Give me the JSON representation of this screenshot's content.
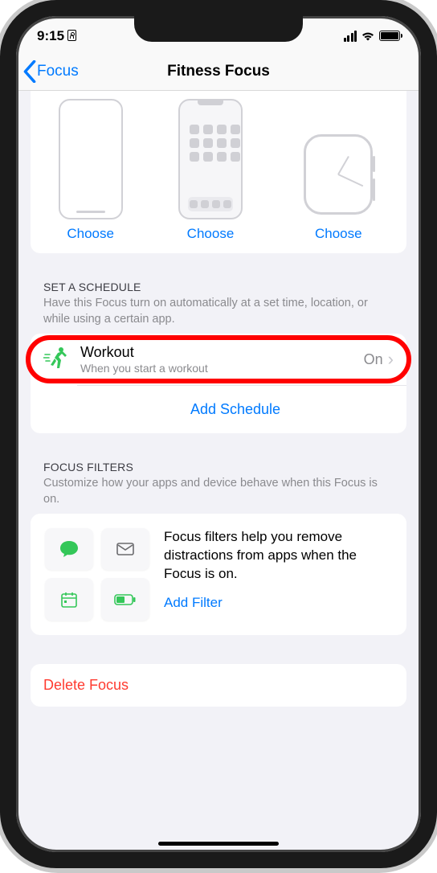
{
  "status": {
    "time": "9:15"
  },
  "nav": {
    "back_label": "Focus",
    "title": "Fitness Focus"
  },
  "choosers": {
    "lock": "Choose",
    "home": "Choose",
    "watch": "Choose"
  },
  "schedule": {
    "header": "SET A SCHEDULE",
    "sub": "Have this Focus turn on automatically at a set time, location, or while using a certain app.",
    "workout": {
      "title": "Workout",
      "sub": "When you start a workout",
      "status": "On"
    },
    "add": "Add Schedule"
  },
  "filters": {
    "header": "FOCUS FILTERS",
    "sub": "Customize how your apps and device behave when this Focus is on.",
    "body": "Focus filters help you remove distractions from apps when the Focus is on.",
    "add": "Add Filter"
  },
  "delete": {
    "label": "Delete Focus"
  }
}
